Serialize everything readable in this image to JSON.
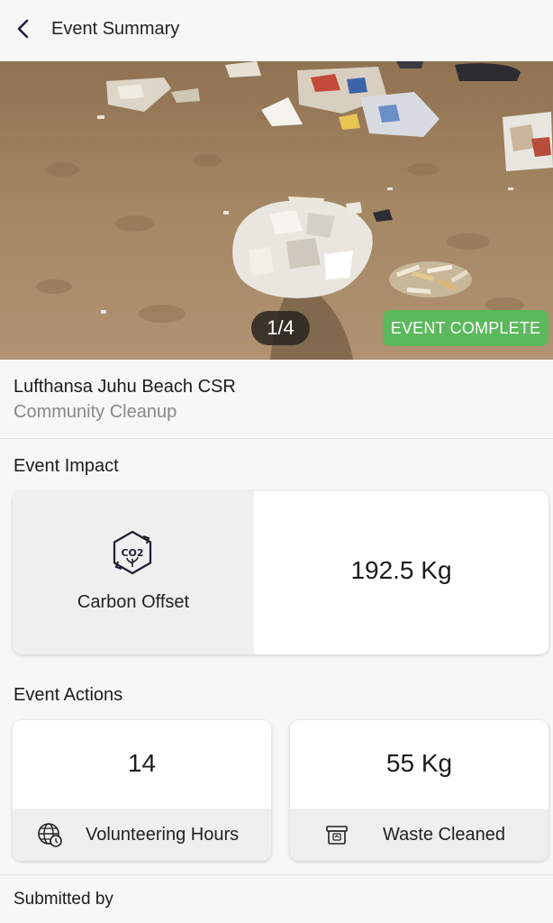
{
  "header": {
    "title": "Event Summary"
  },
  "hero": {
    "page_indicator": "1/4",
    "status_badge": "EVENT COMPLETE"
  },
  "event": {
    "name": "Lufthansa Juhu Beach CSR",
    "type": "Community Cleanup"
  },
  "impact": {
    "title": "Event Impact",
    "icon_text": "CO2",
    "metric_label": "Carbon Offset",
    "metric_value": "192.5 Kg"
  },
  "actions": {
    "title": "Event Actions",
    "items": [
      {
        "value": "14",
        "label": "Volunteering Hours",
        "icon": "globe-clock-icon"
      },
      {
        "value": "55 Kg",
        "label": "Waste Cleaned",
        "icon": "waste-bin-icon"
      }
    ]
  },
  "submitted": {
    "title": "Submitted by"
  },
  "colors": {
    "badge": "#5cb85c",
    "background": "#f7f7f7"
  }
}
